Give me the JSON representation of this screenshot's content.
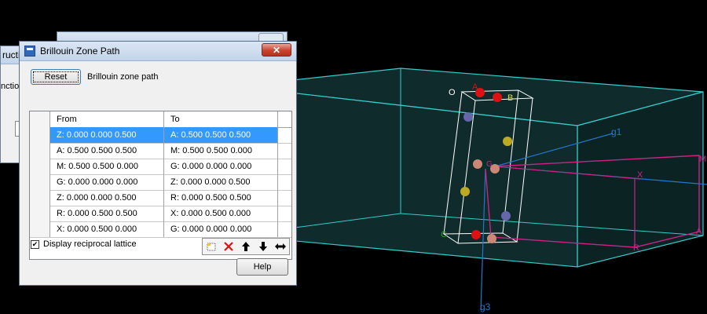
{
  "scene": {
    "labels": [
      "O",
      "A",
      "B",
      "g1",
      "X",
      "M",
      "A",
      "R",
      "C",
      "g3",
      "G"
    ]
  },
  "background_window": {
    "partial_title": "ructi",
    "partial_label": "nctio"
  },
  "dialog": {
    "title": "Brillouin Zone Path",
    "close_symbol": "✕",
    "reset_label": "Reset",
    "path_label": "Brillouin zone path",
    "columns": [
      "From",
      "To"
    ],
    "rows": [
      {
        "from": "Z:  0.000  0.000  0.500",
        "to": "A:  0.500  0.500  0.500"
      },
      {
        "from": "A:  0.500  0.500  0.500",
        "to": "M:  0.500  0.500  0.000"
      },
      {
        "from": "M:  0.500  0.500  0.000",
        "to": "G:  0.000  0.000  0.000"
      },
      {
        "from": "G:  0.000  0.000  0.000",
        "to": "Z:  0.000  0.000  0.500"
      },
      {
        "from": "Z:  0.000  0.000  0.500",
        "to": "R:  0.000  0.500  0.500"
      },
      {
        "from": "R:  0.000  0.500  0.500",
        "to": "X:  0.000  0.500  0.000"
      },
      {
        "from": "X:  0.000  0.500  0.000",
        "to": "G:  0.000  0.000  0.000"
      }
    ],
    "selected_row": 0,
    "display_lattice_label": "Display reciprocal lattice",
    "display_lattice_checked": true,
    "help_label": "Help",
    "toolbar_icons": [
      "new-row-icon",
      "delete-icon",
      "arrow-up-icon",
      "arrow-down-icon",
      "swap-icon"
    ]
  },
  "colors": {
    "cell_edge": "#33cccc",
    "path": "#cc2288",
    "axis": "#2277cc",
    "selection": "#3399ff"
  }
}
